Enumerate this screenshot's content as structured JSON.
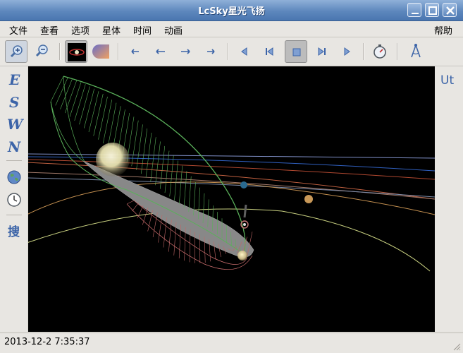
{
  "window": {
    "title": "LcSky星光飞扬"
  },
  "menu": {
    "items": [
      "文件",
      "查看",
      "选项",
      "星体",
      "时间",
      "动画"
    ],
    "help": "帮助"
  },
  "sidebar": {
    "directions": [
      "E",
      "S",
      "W",
      "N"
    ],
    "search_label": "搜"
  },
  "rightbar": {
    "ut_label": "Ut"
  },
  "status": {
    "datetime": "2013-12-2 7:35:37"
  }
}
